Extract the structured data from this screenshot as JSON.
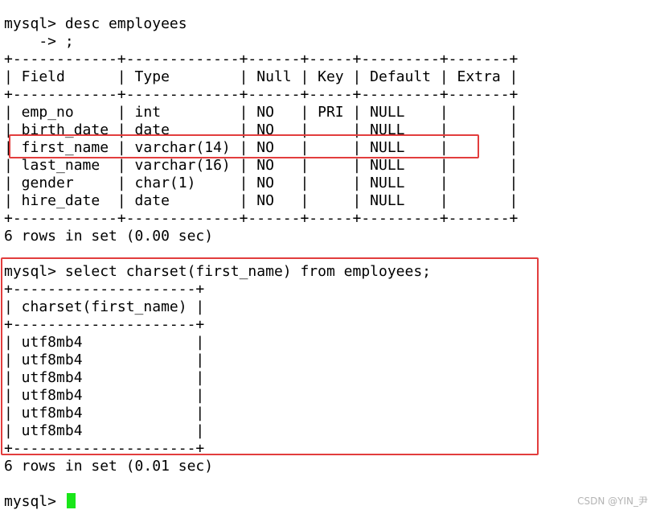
{
  "terminal": {
    "lines": [
      "mysql> desc employees",
      "    -> ;",
      "+------------+-------------+------+-----+---------+-------+",
      "| Field      | Type        | Null | Key | Default | Extra |",
      "+------------+-------------+------+-----+---------+-------+",
      "| emp_no     | int         | NO   | PRI | NULL    |       |",
      "| birth_date | date        | NO   |     | NULL    |       |",
      "| first_name | varchar(14) | NO   |     | NULL    |       |",
      "| last_name  | varchar(16) | NO   |     | NULL    |       |",
      "| gender     | char(1)     | NO   |     | NULL    |       |",
      "| hire_date  | date        | NO   |     | NULL    |       |",
      "+------------+-------------+------+-----+---------+-------+",
      "6 rows in set (0.00 sec)",
      "",
      "mysql> select charset(first_name) from employees;",
      "+---------------------+",
      "| charset(first_name) |",
      "+---------------------+",
      "| utf8mb4             |",
      "| utf8mb4             |",
      "| utf8mb4             |",
      "| utf8mb4             |",
      "| utf8mb4             |",
      "| utf8mb4             |",
      "+---------------------+",
      "6 rows in set (0.01 sec)",
      ""
    ],
    "prompt": "mysql> ",
    "cursor_color": "#19e619"
  },
  "annotations": {
    "highlight_color": "#e23d3d"
  },
  "watermark": {
    "text": "CSDN @YIN_尹"
  }
}
